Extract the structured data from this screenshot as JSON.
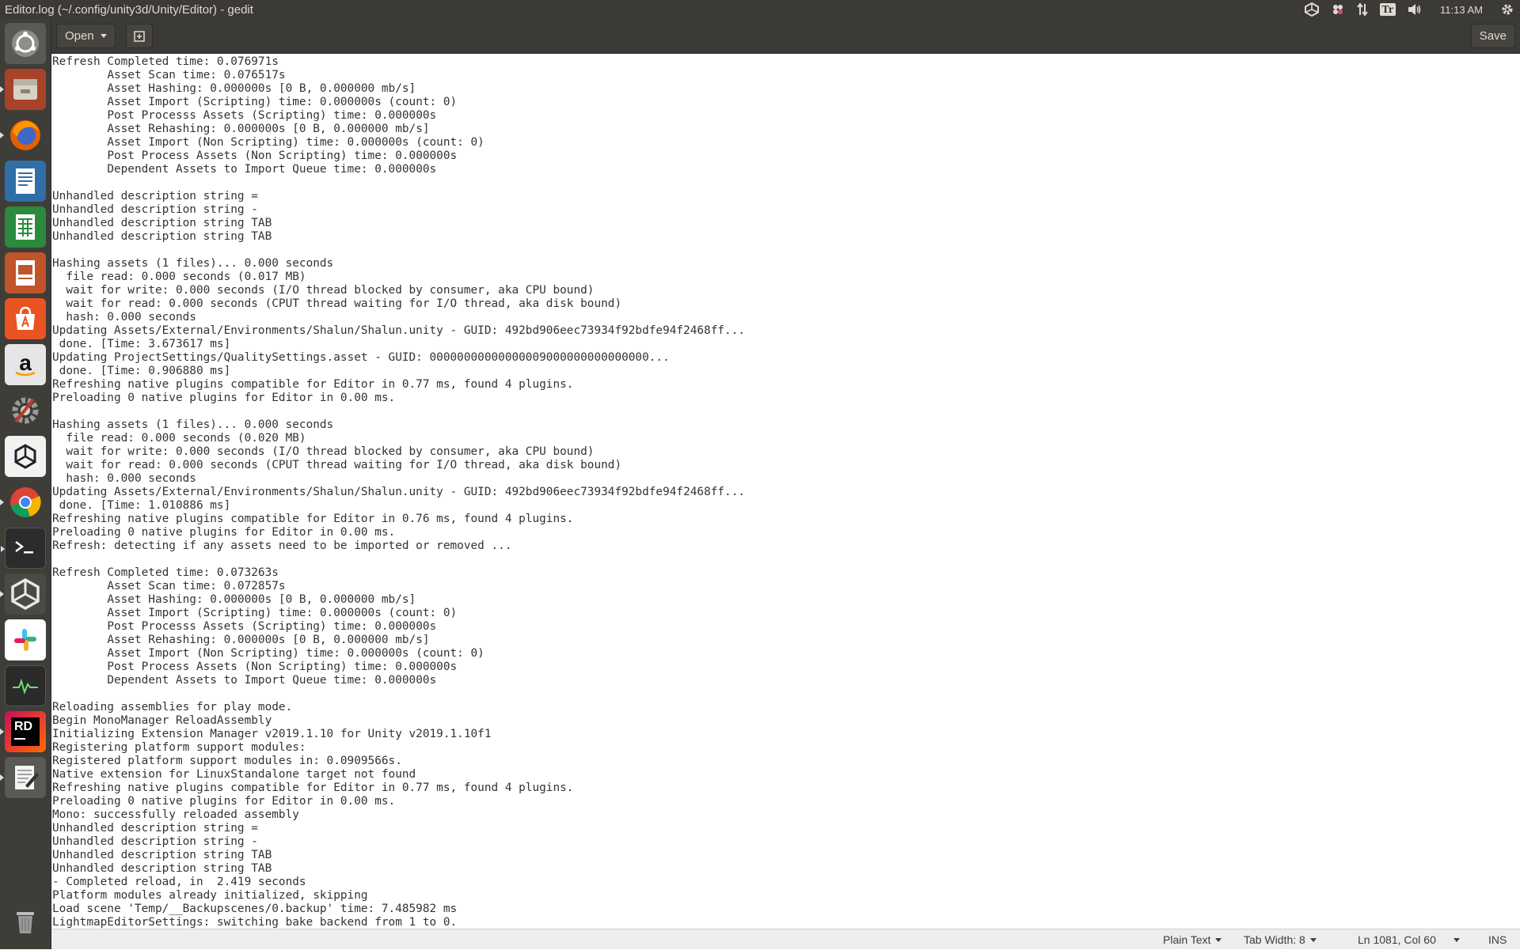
{
  "window": {
    "title": "Editor.log (~/.config/unity3d/Unity/Editor) - gedit"
  },
  "top_panel": {
    "clock": "11:13 AM",
    "indicators": [
      "unity-icon",
      "slack-notification-icon",
      "network-icon",
      "keyboard-layout-icon",
      "volume-icon",
      "gear-icon"
    ],
    "keyboard_label": "Tr"
  },
  "launcher": {
    "items": [
      {
        "name": "dash-home-icon",
        "color": "#c9c7c2"
      },
      {
        "name": "files-icon",
        "color": "#b5462b"
      },
      {
        "name": "firefox-icon",
        "color": "#e66000"
      },
      {
        "name": "libreoffice-writer-icon",
        "color": "#2f6ea6"
      },
      {
        "name": "libreoffice-calc-icon",
        "color": "#2b8a3e"
      },
      {
        "name": "libreoffice-impress-icon",
        "color": "#c1542a"
      },
      {
        "name": "ubuntu-software-icon",
        "color": "#e95420"
      },
      {
        "name": "amazon-icon",
        "color": "#e6e6e6"
      },
      {
        "name": "system-settings-icon",
        "color": "#7d7d7d"
      },
      {
        "name": "unity-hub-icon",
        "color": "#f2f2f2"
      },
      {
        "name": "chrome-icon",
        "color": "#4285f4"
      },
      {
        "name": "terminal-icon",
        "color": "#2c2c2c"
      },
      {
        "name": "unity-editor-icon",
        "color": "#dddddd"
      },
      {
        "name": "slack-icon",
        "color": "#ffffff"
      },
      {
        "name": "system-monitor-icon",
        "color": "#2b2b2b"
      },
      {
        "name": "rider-icon",
        "color": "#c90f5e"
      },
      {
        "name": "gedit-icon",
        "color": "#e8e8e8"
      },
      {
        "name": "trash-icon",
        "color": "#9a9a9a"
      }
    ],
    "rd_label": "RD"
  },
  "header": {
    "open_label": "Open",
    "save_label": "Save"
  },
  "editor": {
    "lines": [
      "Refresh Completed time: 0.076971s",
      "\tAsset Scan time: 0.076517s",
      "\tAsset Hashing: 0.000000s [0 B, 0.000000 mb/s]",
      "\tAsset Import (Scripting) time: 0.000000s (count: 0)",
      "\tPost Processs Assets (Scripting) time: 0.000000s",
      "\tAsset Rehashing: 0.000000s [0 B, 0.000000 mb/s]",
      "\tAsset Import (Non Scripting) time: 0.000000s (count: 0)",
      "\tPost Process Assets (Non Scripting) time: 0.000000s",
      "\tDependent Assets to Import Queue time: 0.000000s",
      "",
      "Unhandled description string =",
      "Unhandled description string -",
      "Unhandled description string TAB",
      "Unhandled description string TAB",
      "",
      "Hashing assets (1 files)... 0.000 seconds",
      "  file read: 0.000 seconds (0.017 MB)",
      "  wait for write: 0.000 seconds (I/O thread blocked by consumer, aka CPU bound)",
      "  wait for read: 0.000 seconds (CPUT thread waiting for I/O thread, aka disk bound)",
      "  hash: 0.000 seconds",
      "Updating Assets/External/Environments/Shalun/Shalun.unity - GUID: 492bd906eec73934f92bdfe94f2468ff...",
      " done. [Time: 3.673617 ms]",
      "Updating ProjectSettings/QualitySettings.asset - GUID: 00000000000000009000000000000000...",
      " done. [Time: 0.906880 ms]",
      "Refreshing native plugins compatible for Editor in 0.77 ms, found 4 plugins.",
      "Preloading 0 native plugins for Editor in 0.00 ms.",
      "",
      "Hashing assets (1 files)... 0.000 seconds",
      "  file read: 0.000 seconds (0.020 MB)",
      "  wait for write: 0.000 seconds (I/O thread blocked by consumer, aka CPU bound)",
      "  wait for read: 0.000 seconds (CPUT thread waiting for I/O thread, aka disk bound)",
      "  hash: 0.000 seconds",
      "Updating Assets/External/Environments/Shalun/Shalun.unity - GUID: 492bd906eec73934f92bdfe94f2468ff...",
      " done. [Time: 1.010886 ms]",
      "Refreshing native plugins compatible for Editor in 0.76 ms, found 4 plugins.",
      "Preloading 0 native plugins for Editor in 0.00 ms.",
      "Refresh: detecting if any assets need to be imported or removed ...",
      "",
      "Refresh Completed time: 0.073263s",
      "\tAsset Scan time: 0.072857s",
      "\tAsset Hashing: 0.000000s [0 B, 0.000000 mb/s]",
      "\tAsset Import (Scripting) time: 0.000000s (count: 0)",
      "\tPost Processs Assets (Scripting) time: 0.000000s",
      "\tAsset Rehashing: 0.000000s [0 B, 0.000000 mb/s]",
      "\tAsset Import (Non Scripting) time: 0.000000s (count: 0)",
      "\tPost Process Assets (Non Scripting) time: 0.000000s",
      "\tDependent Assets to Import Queue time: 0.000000s",
      "",
      "Reloading assemblies for play mode.",
      "Begin MonoManager ReloadAssembly",
      "Initializing Extension Manager v2019.1.10 for Unity v2019.1.10f1",
      "Registering platform support modules:",
      "Registered platform support modules in: 0.0909566s.",
      "Native extension for LinuxStandalone target not found",
      "Refreshing native plugins compatible for Editor in 0.77 ms, found 4 plugins.",
      "Preloading 0 native plugins for Editor in 0.00 ms.",
      "Mono: successfully reloaded assembly",
      "Unhandled description string =",
      "Unhandled description string -",
      "Unhandled description string TAB",
      "Unhandled description string TAB",
      "- Completed reload, in  2.419 seconds",
      "Platform modules already initialized, skipping",
      "Load scene 'Temp/__Backupscenes/0.backup' time: 7.485982 ms",
      "LightmapEditorSettings: switching bake backend from 1 to 0."
    ]
  },
  "status_bar": {
    "language": "Plain Text",
    "tab_width": "Tab Width: 8",
    "cursor_position": "Ln 1081, Col 60",
    "insert_mode": "INS"
  }
}
